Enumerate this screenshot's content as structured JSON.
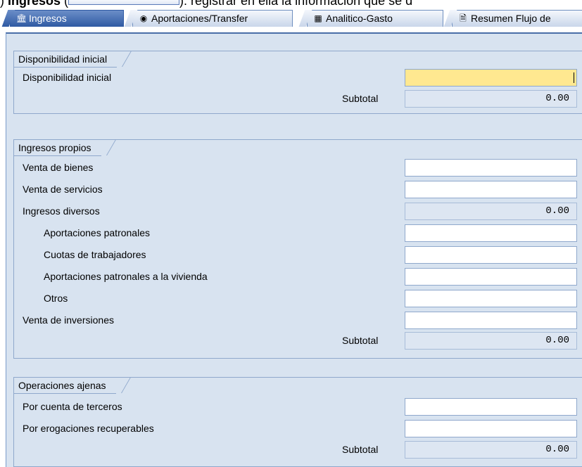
{
  "caption": {
    "bold": "Ingresos",
    "prefix": ") ",
    "open_paren": " (",
    "rest": "): registrar en ella la información que se d"
  },
  "tabs": [
    {
      "label": "Ingresos",
      "icon": "bank-icon",
      "active": true
    },
    {
      "label": "Aportaciones/Transfer",
      "icon": "coin-icon",
      "active": false
    },
    {
      "label": "Analitico-Gasto",
      "icon": "table-icon",
      "active": false
    },
    {
      "label": "Resumen Flujo de",
      "icon": "document-icon",
      "active": false
    }
  ],
  "groups": {
    "disponibilidad": {
      "title": "Disponibilidad inicial",
      "row_label": "Disponibilidad inicial",
      "row_value": "",
      "subtotal_label": "Subtotal",
      "subtotal_value": "0.00"
    },
    "ingresos_propios": {
      "title": "Ingresos propios",
      "rows": [
        {
          "label": "Venta de bienes",
          "value": ""
        },
        {
          "label": "Venta de servicios",
          "value": ""
        },
        {
          "label": "Ingresos diversos",
          "value": "0.00"
        },
        {
          "label": "Aportaciones patronales",
          "value": ""
        },
        {
          "label": "Cuotas de trabajadores",
          "value": ""
        },
        {
          "label": "Aportaciones patronales a la vivienda",
          "value": ""
        },
        {
          "label": "Otros",
          "value": ""
        },
        {
          "label": "Venta de inversiones",
          "value": ""
        }
      ],
      "subtotal_label": "Subtotal",
      "subtotal_value": "0.00"
    },
    "operaciones_ajenas": {
      "title": "Operaciones ajenas",
      "rows": [
        {
          "label": "Por cuenta de terceros",
          "value": ""
        },
        {
          "label": "Por erogaciones recuperables",
          "value": ""
        }
      ],
      "subtotal_label": "Subtotal",
      "subtotal_value": "0.00"
    }
  },
  "colors": {
    "panel_bg": "#d8e3f0",
    "focus_field": "#ffe890",
    "active_tab": "#2f5aa3"
  }
}
